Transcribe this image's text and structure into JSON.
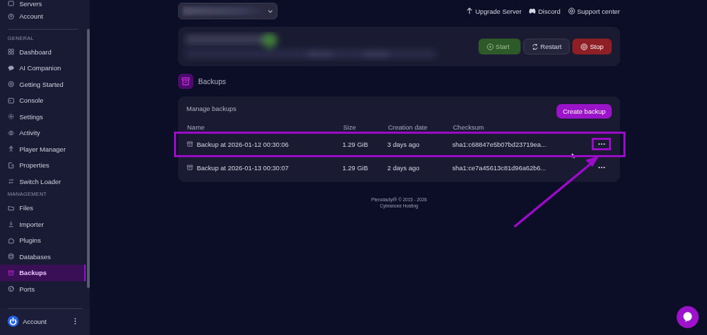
{
  "sidebar": {
    "top_items": [
      {
        "label": "Servers",
        "selected": false
      },
      {
        "label": "Account",
        "selected": false
      }
    ],
    "sections": [
      {
        "heading": "GENERAL",
        "items": [
          {
            "label": "Dashboard",
            "selected": false
          },
          {
            "label": "AI Companion",
            "selected": false
          },
          {
            "label": "Getting Started",
            "selected": false
          },
          {
            "label": "Console",
            "selected": false
          },
          {
            "label": "Settings",
            "selected": false
          },
          {
            "label": "Activity",
            "selected": false
          },
          {
            "label": "Player Manager",
            "selected": false
          },
          {
            "label": "Properties",
            "selected": false
          },
          {
            "label": "Switch Loader",
            "selected": false
          }
        ]
      },
      {
        "heading": "MANAGEMENT",
        "items": [
          {
            "label": "Files",
            "selected": false
          },
          {
            "label": "Importer",
            "selected": false
          },
          {
            "label": "Plugins",
            "selected": false
          },
          {
            "label": "Databases",
            "selected": false
          },
          {
            "label": "Backups",
            "selected": true
          },
          {
            "label": "Ports",
            "selected": false
          }
        ]
      }
    ],
    "user": {
      "name": "Account"
    }
  },
  "top_links": [
    {
      "label": "Upgrade Server"
    },
    {
      "label": "Discord"
    },
    {
      "label": "Support center"
    }
  ],
  "power_buttons": [
    {
      "label": "Start",
      "kind": "start"
    },
    {
      "label": "Restart",
      "kind": "restart"
    },
    {
      "label": "Stop",
      "kind": "stop"
    }
  ],
  "page_title": "Backups",
  "backups": {
    "title": "Manage backups",
    "create_button": "Create backup",
    "columns": [
      "Name",
      "Size",
      "Creation date",
      "Checksum"
    ],
    "rows": [
      {
        "name": "Backup at 2026-01-12 00:30:06",
        "size": "1.29 GiB",
        "created": "3 days ago",
        "checksum": "sha1:c68847e5b07bd23719ea...",
        "highlighted": true
      },
      {
        "name": "Backup at 2026-01-13 00:30:07",
        "size": "1.29 GiB",
        "created": "2 days ago",
        "checksum": "sha1:ce7a45613c81d96a62b6...",
        "highlighted": false
      }
    ]
  },
  "footer": [
    "Pterodactyl® © 2015 - 2026",
    "Cybrancee Hosting"
  ]
}
